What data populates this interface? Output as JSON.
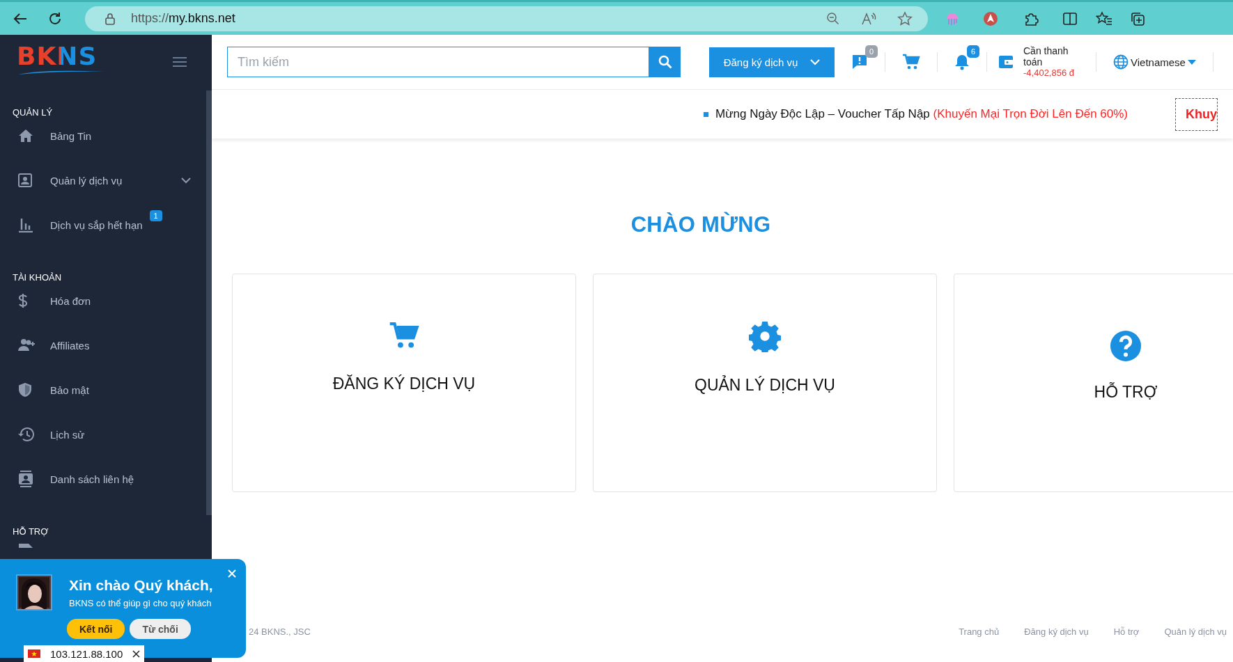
{
  "browser": {
    "url_scheme": "https://",
    "url_host": "my.bkns.net"
  },
  "sidebar": {
    "logo": "BKNS",
    "sections": [
      {
        "heading": "QUẢN LÝ",
        "items": [
          {
            "label": "Bảng Tin",
            "expandable": false
          },
          {
            "label": "Quản lý dịch vụ",
            "expandable": true
          },
          {
            "label": "Dịch vụ sắp hết hạn",
            "expandable": false,
            "badge": "1"
          }
        ]
      },
      {
        "heading": "TÀI KHOẢN",
        "items": [
          {
            "label": "Hóa đơn",
            "expandable": false
          },
          {
            "label": "Affiliates",
            "expandable": false
          },
          {
            "label": "Bảo mật",
            "expandable": false
          },
          {
            "label": "Lịch sử",
            "expandable": false
          },
          {
            "label": "Danh sách liên hệ",
            "expandable": false
          }
        ]
      },
      {
        "heading": "HỖ TRỢ"
      }
    ]
  },
  "header": {
    "search": {
      "placeholder": "Tìm kiếm"
    },
    "register_button": "Đăng ký dịch vụ",
    "messages_badge": "0",
    "notifications_badge": "6",
    "balance": {
      "label": "Cần thanh toán",
      "amount": "-4,402,856 đ"
    },
    "language": "Vietnamese"
  },
  "ticker": {
    "text": "Mừng Ngày Độc Lập – Voucher Tấp Nập",
    "highlight": "(Khuyến Mại Trọn Đời Lên Đến 60%)",
    "promo": "Khuy"
  },
  "welcome": {
    "title": "CHÀO MỪNG",
    "cards": [
      {
        "label": "ĐĂNG KÝ DỊCH VỤ"
      },
      {
        "label": "QUẢN LÝ DỊCH VỤ"
      },
      {
        "label": "HỖ TRỢ"
      }
    ]
  },
  "footer": {
    "copyright": "24 BKNS., JSC",
    "links": [
      "Trang chủ",
      "Đăng ký dịch vụ",
      "Hỗ trợ",
      "Quản lý dịch vụ"
    ]
  },
  "chat_popup": {
    "title": "Xin chào Quý khách,",
    "message": "BKNS có thể giúp gì cho quý khách",
    "buttons": [
      "Kết nối",
      "Từ chối"
    ]
  },
  "ip_tag": {
    "address": "103.121.88.100"
  }
}
